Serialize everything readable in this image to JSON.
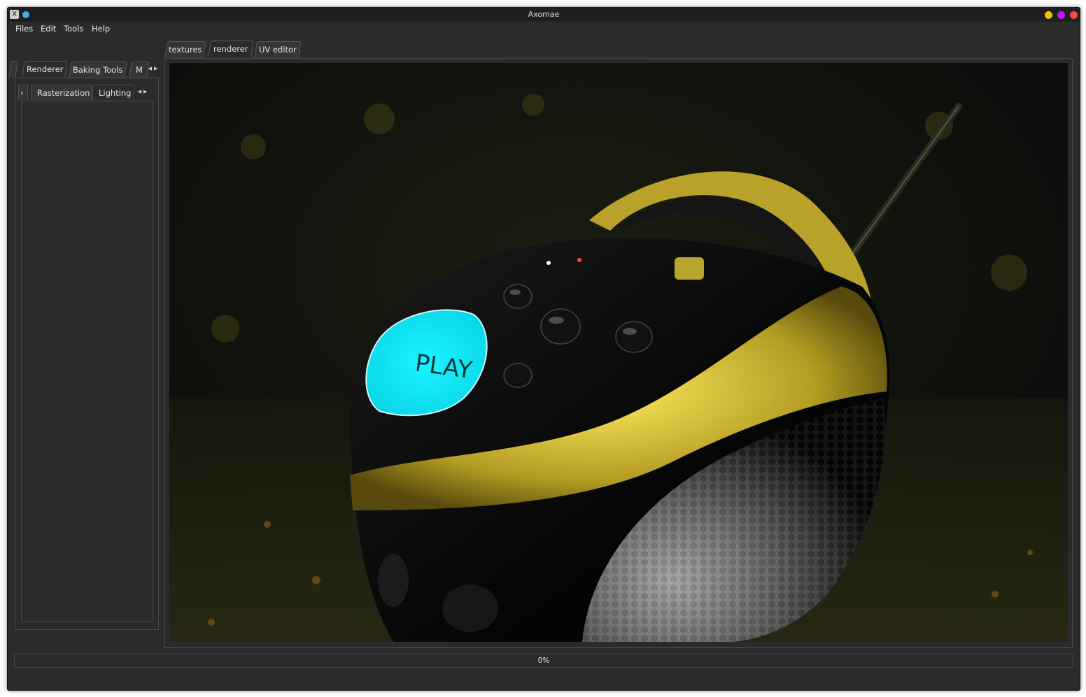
{
  "window": {
    "title": "Axomae",
    "app_icon_glyph": "X",
    "controls": [
      {
        "name": "minimize",
        "color": "#f4c20d"
      },
      {
        "name": "maximize",
        "color": "#b51cf0"
      },
      {
        "name": "close",
        "color": "#f04a4a"
      }
    ]
  },
  "menubar": {
    "items": [
      "Files",
      "Edit",
      "Tools",
      "Help"
    ]
  },
  "left_dock": {
    "tabs": [
      "Renderer",
      "Baking Tools",
      "M"
    ],
    "active_tab": "Renderer",
    "sub_tabs": [
      "Rasterization",
      "Lighting"
    ],
    "active_sub_tab": "Lighting"
  },
  "main_tabs": {
    "items": [
      "textures",
      "renderer",
      "UV editor"
    ],
    "active": "renderer"
  },
  "viewport": {
    "label_text": "PLAY",
    "accent_color": "#0ee6f0",
    "body_color": "#c9b232"
  },
  "progress": {
    "value": 0,
    "label": "0%",
    "accent": "#3daee9"
  }
}
